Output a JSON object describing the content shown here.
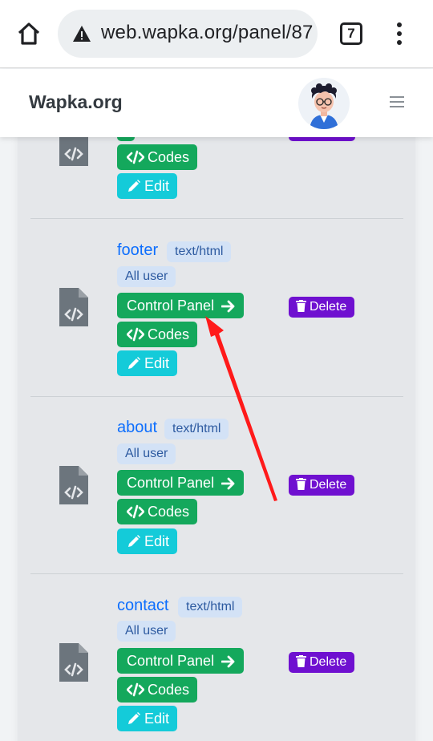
{
  "browser": {
    "url": "web.wapka.org/panel/87",
    "tab_count": "7"
  },
  "header": {
    "brand": "Wapka.org"
  },
  "labels": {
    "control_panel": "Control Panel",
    "codes": "Codes",
    "edit": "Edit",
    "delete": "Delete"
  },
  "items": [
    {
      "name": "",
      "type": "",
      "access": ""
    },
    {
      "name": "footer",
      "type": "text/html",
      "access": "All user"
    },
    {
      "name": "about",
      "type": "text/html",
      "access": "All user"
    },
    {
      "name": "contact",
      "type": "text/html",
      "access": "All user"
    }
  ],
  "colors": {
    "green": "#14a85c",
    "cyan": "#14cbd9",
    "purple": "#6f10d0",
    "link_blue": "#0d6efd",
    "annotation_arrow": "#ff1a1a"
  }
}
